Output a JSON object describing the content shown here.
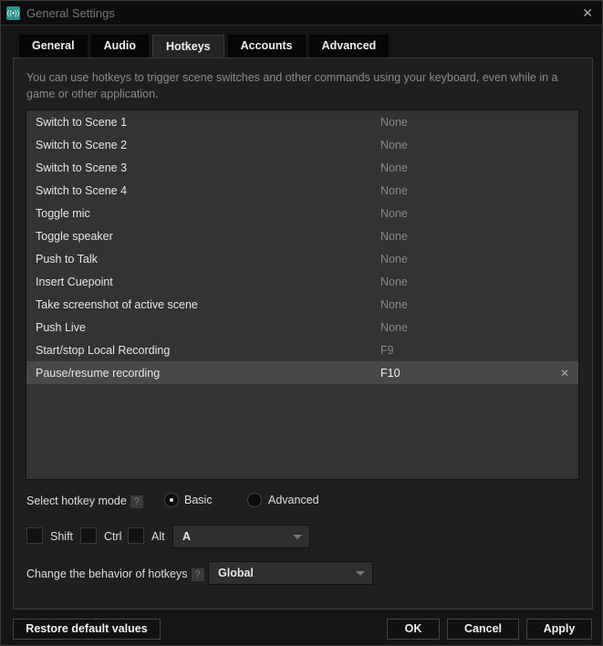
{
  "window": {
    "title": "General Settings",
    "close": "✕",
    "logo": "((•))"
  },
  "tabs": [
    {
      "label": "General"
    },
    {
      "label": "Audio"
    },
    {
      "label": "Hotkeys"
    },
    {
      "label": "Accounts"
    },
    {
      "label": "Advanced"
    }
  ],
  "description": "You can use hotkeys to trigger scene switches and other commands using your keyboard, even while in a game or other application.",
  "hotkeys": [
    {
      "name": "Switch to Scene 1",
      "key": "None"
    },
    {
      "name": "Switch to Scene 2",
      "key": "None"
    },
    {
      "name": "Switch to Scene 3",
      "key": "None"
    },
    {
      "name": "Switch to Scene 4",
      "key": "None"
    },
    {
      "name": "Toggle mic",
      "key": "None"
    },
    {
      "name": "Toggle speaker",
      "key": "None"
    },
    {
      "name": "Push to Talk",
      "key": "None"
    },
    {
      "name": "Insert Cuepoint",
      "key": "None"
    },
    {
      "name": "Take screenshot of active scene",
      "key": "None"
    },
    {
      "name": "Push Live",
      "key": "None"
    },
    {
      "name": "Start/stop Local Recording",
      "key": "F9"
    },
    {
      "name": "Pause/resume recording",
      "key": "F10",
      "clear": "✕"
    }
  ],
  "mode": {
    "label": "Select hotkey mode",
    "help": "?",
    "options": [
      "Basic",
      "Advanced"
    ],
    "selected": "Basic"
  },
  "modifiers": {
    "shift": "Shift",
    "ctrl": "Ctrl",
    "alt": "Alt",
    "key": "A"
  },
  "behavior": {
    "label": "Change the behavior of hotkeys",
    "help": "?",
    "value": "Global"
  },
  "buttons": {
    "restore": "Restore default values",
    "ok": "OK",
    "cancel": "Cancel",
    "apply": "Apply"
  }
}
